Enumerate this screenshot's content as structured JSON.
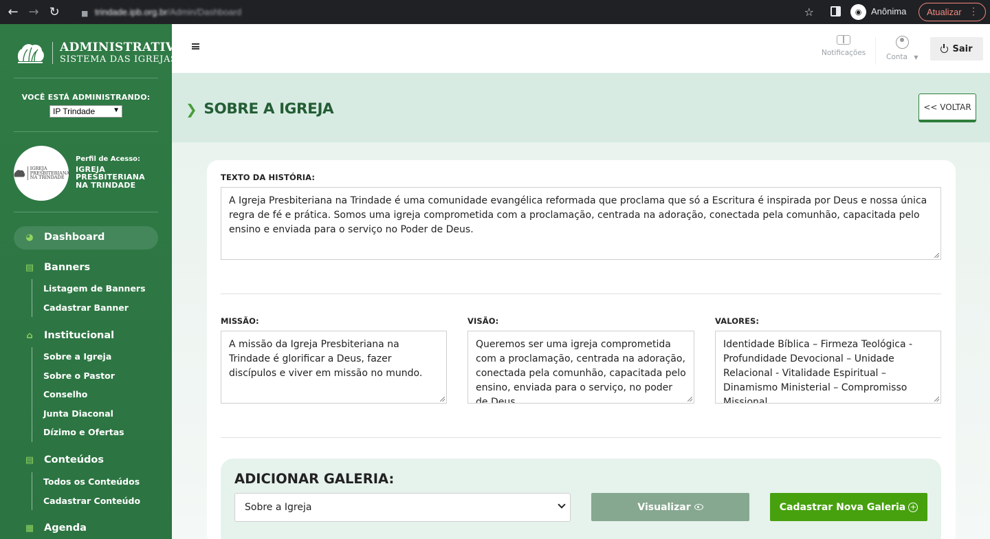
{
  "browser": {
    "url_host": "trindade.ipb.org.br",
    "url_path": "/Admin/Dashboard",
    "profile_label": "Anônima",
    "update_label": "Atualizar"
  },
  "sidebar": {
    "brand_line1": "ADMINISTRATIVO",
    "brand_line2": "SISTEMA DAS IGREJAS",
    "admin_label": "VOCÊ ESTÁ ADMINISTRANDO:",
    "church_selected": "IP Trindade",
    "profile_label": "Perfil de Acesso:",
    "profile_name": "IGREJA PRESBITERIANA NA TRINDADE",
    "avatar_line1": "IGREJA",
    "avatar_line2": "PRESBITERIANA",
    "avatar_line3": "NA TRINDADE",
    "nav": {
      "dashboard": "Dashboard",
      "banners": "Banners",
      "banners_items": [
        "Listagem de Banners",
        "Cadastrar Banner"
      ],
      "institucional": "Institucional",
      "institucional_items": [
        "Sobre a Igreja",
        "Sobre o Pastor",
        "Conselho",
        "Junta Diaconal",
        "Dízimo e Ofertas"
      ],
      "conteudos": "Conteúdos",
      "conteudos_items": [
        "Todos os Conteúdos",
        "Cadastrar Conteúdo"
      ],
      "agenda": "Agenda"
    }
  },
  "topbar": {
    "notifications": "Notificações",
    "account": "Conta",
    "logout": "Sair"
  },
  "page": {
    "title": "SOBRE A IGREJA",
    "back": "<< VOLTAR"
  },
  "form": {
    "history_label": "TEXTO DA HISTÓRIA:",
    "history_text": "A Igreja Presbiteriana na Trindade é uma comunidade evangélica reformada que proclama que só a Escritura é inspirada por Deus e nossa única regra de fé e prática. Somos uma igreja comprometida com a proclamação, centrada na adoração, conectada pela comunhão, capacitada pelo ensino e enviada para o serviço no Poder de Deus.",
    "mission_label": "MISSÃO:",
    "mission_text": "A missão da Igreja Presbiteriana na Trindade é glorificar a Deus, fazer discípulos e viver em missão no mundo.",
    "vision_label": "VISÃO:",
    "vision_text": "Queremos ser uma igreja comprometida com a proclamação, centrada na adoração, conectada pela comunhão, capacitada pelo ensino, enviada para o serviço, no poder de Deus.",
    "values_label": "VALORES:",
    "values_text": "Identidade Bíblica – Firmeza Teológica - Profundidade Devocional – Unidade Relacional - Vitalidade Espiritual – Dinamismo Ministerial – Compromisso Missional"
  },
  "gallery": {
    "title": "ADICIONAR GALERIA:",
    "select_value": "Sobre a Igreja",
    "view_button": "Visualizar",
    "new_button": "Cadastrar Nova Galeria"
  },
  "colors": {
    "sidebar_green": "#2f7a45",
    "header_mint": "#d7ebe3",
    "title_green": "#245d35",
    "primary_button": "#47a10f",
    "secondary_button": "#86a890"
  }
}
